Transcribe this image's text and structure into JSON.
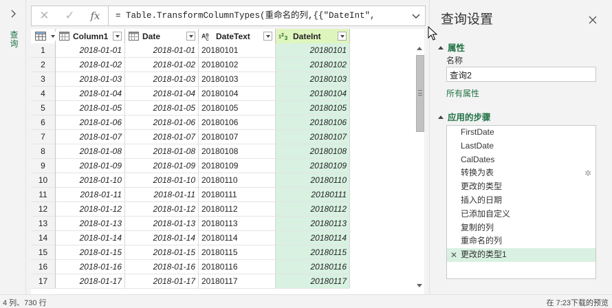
{
  "query_pane": {
    "label": "查询",
    "expand_icon": "chevron-right-icon"
  },
  "formula_bar": {
    "cancel_icon": "✕",
    "commit_icon": "✓",
    "fx_label": "fx",
    "formula": "= Table.TransformColumnTypes(重命名的列,{{\"DateInt\","
  },
  "grid": {
    "columns": [
      {
        "name": "Column1",
        "type_icon": "calendar-icon",
        "selected": false
      },
      {
        "name": "Date",
        "type_icon": "calendar-icon",
        "selected": false
      },
      {
        "name": "DateText",
        "type_icon": "text-type-icon",
        "selected": false
      },
      {
        "name": "DateInt",
        "type_icon": "whole-number-type-icon",
        "selected": true
      }
    ],
    "rows": [
      {
        "n": "1",
        "c1": "2018-01-01",
        "c2": "2018-01-01",
        "c3": "20180101",
        "c4": "20180101"
      },
      {
        "n": "2",
        "c1": "2018-01-02",
        "c2": "2018-01-02",
        "c3": "20180102",
        "c4": "20180102"
      },
      {
        "n": "3",
        "c1": "2018-01-03",
        "c2": "2018-01-03",
        "c3": "20180103",
        "c4": "20180103"
      },
      {
        "n": "4",
        "c1": "2018-01-04",
        "c2": "2018-01-04",
        "c3": "20180104",
        "c4": "20180104"
      },
      {
        "n": "5",
        "c1": "2018-01-05",
        "c2": "2018-01-05",
        "c3": "20180105",
        "c4": "20180105"
      },
      {
        "n": "6",
        "c1": "2018-01-06",
        "c2": "2018-01-06",
        "c3": "20180106",
        "c4": "20180106"
      },
      {
        "n": "7",
        "c1": "2018-01-07",
        "c2": "2018-01-07",
        "c3": "20180107",
        "c4": "20180107"
      },
      {
        "n": "8",
        "c1": "2018-01-08",
        "c2": "2018-01-08",
        "c3": "20180108",
        "c4": "20180108"
      },
      {
        "n": "9",
        "c1": "2018-01-09",
        "c2": "2018-01-09",
        "c3": "20180109",
        "c4": "20180109"
      },
      {
        "n": "10",
        "c1": "2018-01-10",
        "c2": "2018-01-10",
        "c3": "20180110",
        "c4": "20180110"
      },
      {
        "n": "11",
        "c1": "2018-01-11",
        "c2": "2018-01-11",
        "c3": "20180111",
        "c4": "20180111"
      },
      {
        "n": "12",
        "c1": "2018-01-12",
        "c2": "2018-01-12",
        "c3": "20180112",
        "c4": "20180112"
      },
      {
        "n": "13",
        "c1": "2018-01-13",
        "c2": "2018-01-13",
        "c3": "20180113",
        "c4": "20180113"
      },
      {
        "n": "14",
        "c1": "2018-01-14",
        "c2": "2018-01-14",
        "c3": "20180114",
        "c4": "20180114"
      },
      {
        "n": "15",
        "c1": "2018-01-15",
        "c2": "2018-01-15",
        "c3": "20180115",
        "c4": "20180115"
      },
      {
        "n": "16",
        "c1": "2018-01-16",
        "c2": "2018-01-16",
        "c3": "20180116",
        "c4": "20180116"
      },
      {
        "n": "17",
        "c1": "2018-01-17",
        "c2": "2018-01-17",
        "c3": "20180117",
        "c4": "20180117"
      }
    ]
  },
  "settings": {
    "title": "查询设置",
    "close_icon": "close-icon",
    "properties": {
      "heading": "属性",
      "name_label": "名称",
      "name_value": "查询2",
      "all_properties_link": "所有属性"
    },
    "applied_steps": {
      "heading": "应用的步骤",
      "steps": [
        {
          "label": "FirstDate",
          "has_gear": false,
          "active": false
        },
        {
          "label": "LastDate",
          "has_gear": false,
          "active": false
        },
        {
          "label": "CalDates",
          "has_gear": false,
          "active": false
        },
        {
          "label": "转换为表",
          "has_gear": true,
          "active": false
        },
        {
          "label": "更改的类型",
          "has_gear": false,
          "active": false
        },
        {
          "label": "插入的日期",
          "has_gear": false,
          "active": false
        },
        {
          "label": "已添加自定义",
          "has_gear": false,
          "active": false
        },
        {
          "label": "复制的列",
          "has_gear": false,
          "active": false
        },
        {
          "label": "重命名的列",
          "has_gear": false,
          "active": false
        },
        {
          "label": "更改的类型1",
          "has_gear": false,
          "active": true
        }
      ]
    }
  },
  "status_bar": {
    "left": "4 列、730 行",
    "right": "在 7:23下载的预览"
  },
  "colors": {
    "accent": "#217346",
    "selected_column_bg": "#d8f1e1",
    "selected_header_bg": "#dff5be"
  }
}
